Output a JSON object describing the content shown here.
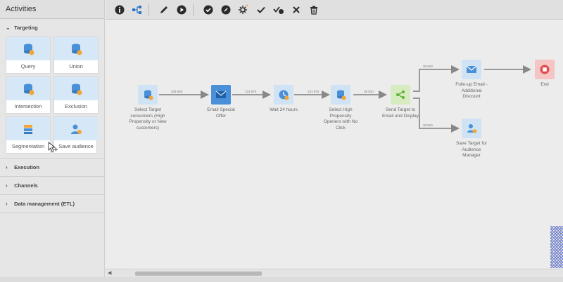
{
  "sidebar": {
    "title": "Activities",
    "sections": [
      {
        "label": "Targeting"
      },
      {
        "label": "Execution"
      },
      {
        "label": "Channels"
      },
      {
        "label": "Data management (ETL)"
      }
    ],
    "tiles": [
      {
        "label": "Query",
        "icon": "database-icon"
      },
      {
        "label": "Union",
        "icon": "union-icon"
      },
      {
        "label": "Intersection",
        "icon": "intersection-icon"
      },
      {
        "label": "Exclusion",
        "icon": "exclusion-icon"
      },
      {
        "label": "Segmentation",
        "icon": "segmentation-icon"
      },
      {
        "label": "Save audience",
        "icon": "save-audience-icon"
      }
    ]
  },
  "toolbar": {
    "buttons": [
      "info-icon",
      "workflow-icon",
      "edit-icon",
      "play-icon",
      "check-circle-icon",
      "edit-circle-icon",
      "settings-icon",
      "check-icon",
      "check-badge-icon",
      "close-icon",
      "trash-icon"
    ]
  },
  "workflow": {
    "nodes": [
      {
        "id": "select-target",
        "label": "Select Target consumers (High Propensity or New customers)"
      },
      {
        "id": "email-offer",
        "label": "Email Special Offer"
      },
      {
        "id": "wait",
        "label": "Wait 24 hours"
      },
      {
        "id": "select-high",
        "label": "Select High Propensity Openers with No Click"
      },
      {
        "id": "send-target",
        "label": "Send Target to Email and Display"
      },
      {
        "id": "follow-up",
        "label": "Follo-up Email - Additional Discount"
      },
      {
        "id": "save-target",
        "label": "Save Target for Audience Manager"
      },
      {
        "id": "end",
        "label": "End"
      }
    ],
    "edges": [
      {
        "label": "205 650"
      },
      {
        "label": "231 870"
      },
      {
        "label": "231 870"
      },
      {
        "label": "38 910"
      },
      {
        "label": "38 910"
      },
      {
        "label": "38 910"
      }
    ]
  },
  "colors": {
    "accent_blue": "#4a90d9",
    "node_light": "#cfe3f5",
    "send_green": "#d6ecc0",
    "end_red": "#f5c4c4"
  }
}
